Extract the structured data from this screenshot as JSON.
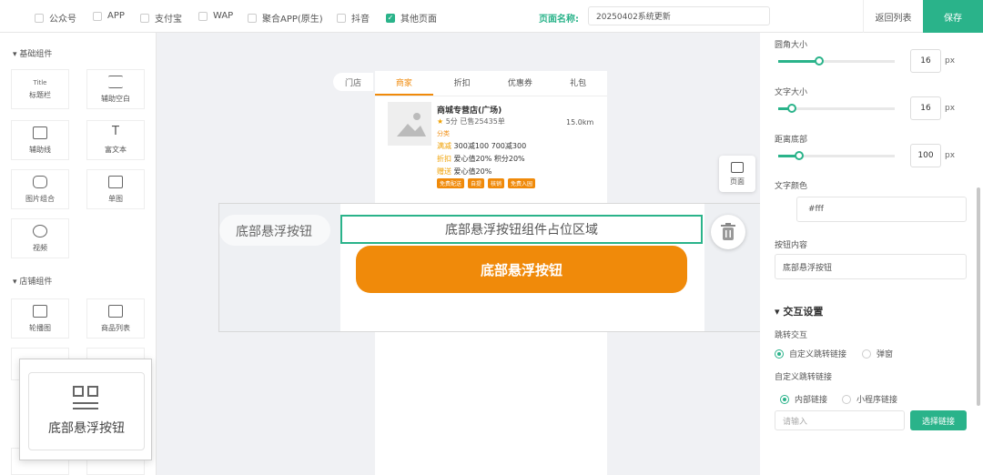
{
  "topbar": {
    "checkboxes": [
      {
        "label": "公众号",
        "checked": false
      },
      {
        "label": "APP",
        "checked": false
      },
      {
        "label": "支付宝",
        "checked": false
      },
      {
        "label": "WAP",
        "checked": false
      },
      {
        "label": "聚合APP(原生)",
        "checked": false
      },
      {
        "label": "抖音",
        "checked": false
      },
      {
        "label": "其他页面",
        "checked": true
      }
    ],
    "page_name_label": "页面名称:",
    "page_name_value": "20250402系统更新",
    "back_label": "返回列表",
    "save_label": "保存"
  },
  "left": {
    "basic_section": "基础组件",
    "basic_items": [
      "标题栏",
      "辅助空白",
      "辅助线",
      "富文本",
      "图片组合",
      "单图",
      "视频"
    ],
    "title_icon_text": "Title",
    "store_section": "店铺组件",
    "store_items": [
      "轮播图",
      "商品列表"
    ],
    "drag_label": "底部悬浮按钮"
  },
  "phone": {
    "side_label": "门店",
    "tabs": [
      "商家",
      "折扣",
      "优惠券",
      "礼包"
    ],
    "store": {
      "name": "商城专营店(广场)",
      "rating": "5分",
      "sold": "已售25435单",
      "distance": "15.0km",
      "tag": "分类",
      "rows": [
        {
          "tag": "满减",
          "text": "300减100   700减300"
        },
        {
          "tag": "折扣",
          "text": "爱心值20%   积分20%"
        },
        {
          "tag": "赠送",
          "text": "爱心值20%"
        }
      ],
      "badges": [
        "免费配送",
        "自提",
        "核销",
        "免费入园"
      ]
    },
    "page_button": "页面"
  },
  "overlay": {
    "side_label": "底部悬浮按钮",
    "placeholder": "底部悬浮按钮组件占位区域",
    "button_label": "底部悬浮按钮"
  },
  "right": {
    "radius_label": "圆角大小",
    "radius_value": "16",
    "radius_fraction": 0.35,
    "font_size_label": "文字大小",
    "font_size_value": "16",
    "font_size_fraction": 0.12,
    "bottom_label": "距离底部",
    "bottom_value": "100",
    "bottom_fraction": 0.18,
    "unit": "px",
    "text_color_label": "文字颜色",
    "text_color_value": "#fff",
    "button_content_label": "按钮内容",
    "button_content_value": "底部悬浮按钮",
    "interaction_title": "交互设置",
    "jump_label": "跳转交互",
    "jump_options": [
      "自定义跳转链接",
      "弹窗"
    ],
    "custom_link_label": "自定义跳转链接",
    "link_options": [
      "内部链接",
      "小程序链接"
    ],
    "link_placeholder": "请输入",
    "select_link_label": "选择链接"
  },
  "colors": {
    "accent": "#2ab38a",
    "orange": "#f08a0a"
  }
}
